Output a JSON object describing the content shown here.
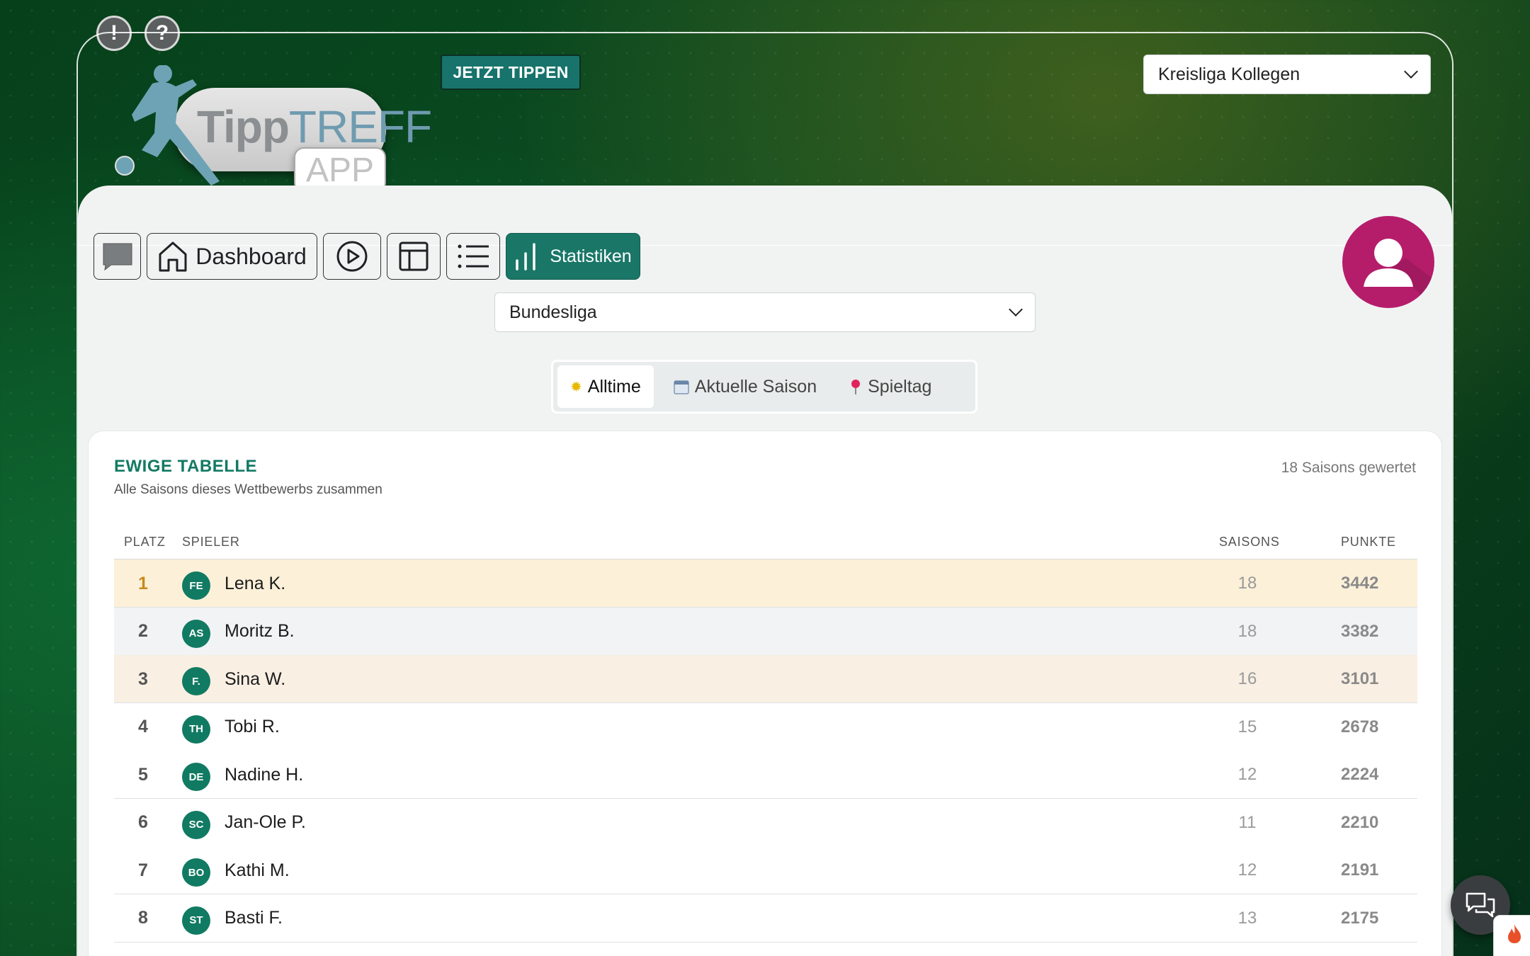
{
  "header": {
    "alert_icon_label": "!",
    "help_icon_label": "?",
    "logo": {
      "word_bold": "Tipp",
      "word_light": "TREFF",
      "badge": "APP"
    },
    "tip_now_label": "JETZT TIPPEN",
    "group_select": {
      "selected": "Kreisliga Kollegen"
    }
  },
  "nav": {
    "dashboard_label": "Dashboard",
    "statistics_label": "Statistiken"
  },
  "competition_select": {
    "selected": "Bundesliga"
  },
  "tabs": [
    {
      "label": "Alltime",
      "icon": "sun-icon",
      "active": true
    },
    {
      "label": "Aktuelle Saison",
      "icon": "calendar-icon",
      "active": false
    },
    {
      "label": "Spieltag",
      "icon": "pin-icon",
      "active": false
    }
  ],
  "table": {
    "title": "EWIGE TABELLE",
    "subtitle": "Alle Saisons dieses Wettbewerbs zusammen",
    "meta": "18 Saisons gewertet",
    "headers": {
      "platz": "PLATZ",
      "spieler": "SPIELER",
      "saisons": "SAISONS",
      "punkte": "PUNKTE"
    },
    "rows": [
      {
        "pos": "1",
        "initials": "FE",
        "name": "Lena K.",
        "saisons": "18",
        "punkte": "3442",
        "highlight": "#fdf0d9",
        "pos_color": "#c88a1a"
      },
      {
        "pos": "2",
        "initials": "AS",
        "name": "Moritz B.",
        "saisons": "18",
        "punkte": "3382",
        "highlight": "#f1f3f4",
        "pos_color": "#555555"
      },
      {
        "pos": "3",
        "initials": "F.",
        "name": "Sina W.",
        "saisons": "16",
        "punkte": "3101",
        "highlight": "#f9efe3",
        "pos_color": "#555555"
      },
      {
        "pos": "4",
        "initials": "TH",
        "name": "Tobi R.",
        "saisons": "15",
        "punkte": "2678",
        "highlight": "#ffffff",
        "pos_color": "#555555"
      },
      {
        "pos": "5",
        "initials": "DE",
        "name": "Nadine H.",
        "saisons": "12",
        "punkte": "2224",
        "highlight": "#ffffff",
        "pos_color": "#555555"
      },
      {
        "pos": "6",
        "initials": "SC",
        "name": "Jan-Ole P.",
        "saisons": "11",
        "punkte": "2210",
        "highlight": "#ffffff",
        "pos_color": "#555555"
      },
      {
        "pos": "7",
        "initials": "BO",
        "name": "Kathi M.",
        "saisons": "12",
        "punkte": "2191",
        "highlight": "#ffffff",
        "pos_color": "#555555"
      },
      {
        "pos": "8",
        "initials": "ST",
        "name": "Basti F.",
        "saisons": "13",
        "punkte": "2175",
        "highlight": "#ffffff",
        "pos_color": "#555555"
      }
    ]
  },
  "colors": {
    "accent": "#1a7768",
    "avatar": "#b51d6b",
    "title": "#137a64"
  }
}
